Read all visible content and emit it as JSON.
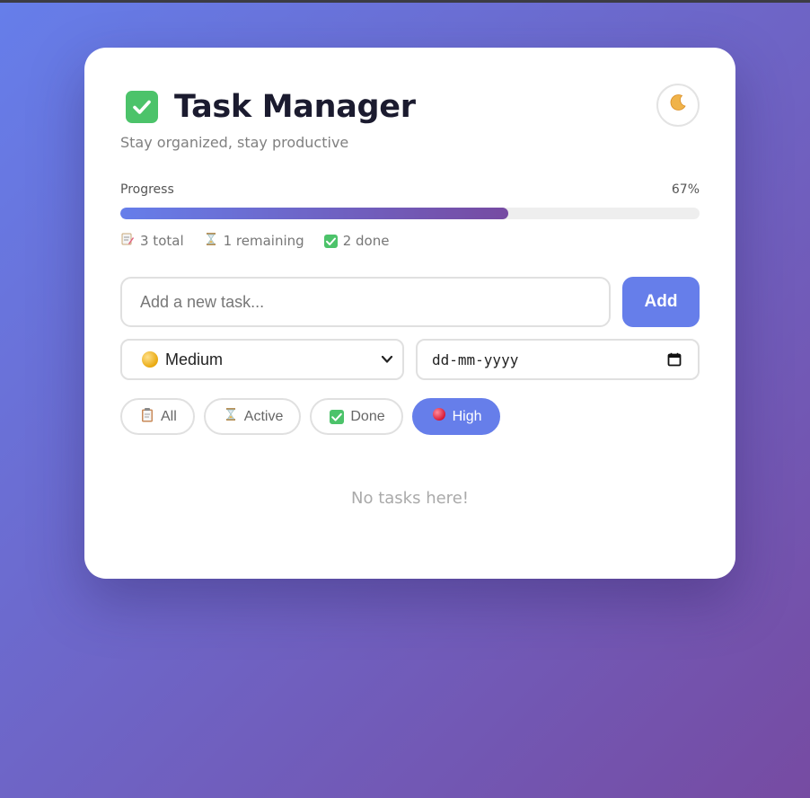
{
  "header": {
    "title": "Task Manager",
    "title_icon": "check-mark-button-icon",
    "subtitle": "Stay organized, stay productive",
    "theme_toggle_icon": "crescent-moon-icon"
  },
  "progress": {
    "label": "Progress",
    "percent_text": "67%",
    "fraction": 0.67
  },
  "stats": {
    "total": "3 total",
    "remaining": "1 remaining",
    "done": "2 done"
  },
  "new_task": {
    "placeholder": "Add a new task...",
    "value": "",
    "add_label": "Add"
  },
  "priority_select": {
    "selected": "Medium",
    "icon": "yellow-circle-icon"
  },
  "due_date": {
    "placeholder": "dd-mm-yyyy"
  },
  "filters": [
    {
      "label": "All",
      "icon": "clipboard-icon",
      "active": false
    },
    {
      "label": "Active",
      "icon": "hourglass-icon",
      "active": false
    },
    {
      "label": "Done",
      "icon": "check-mark-button-icon",
      "active": false
    },
    {
      "label": "High",
      "icon": "red-circle-icon",
      "active": true
    }
  ],
  "empty_message": "No tasks here!",
  "colors": {
    "accent": "#667eea",
    "accent_end": "#764ba2",
    "done_green": "#4cc36a"
  }
}
